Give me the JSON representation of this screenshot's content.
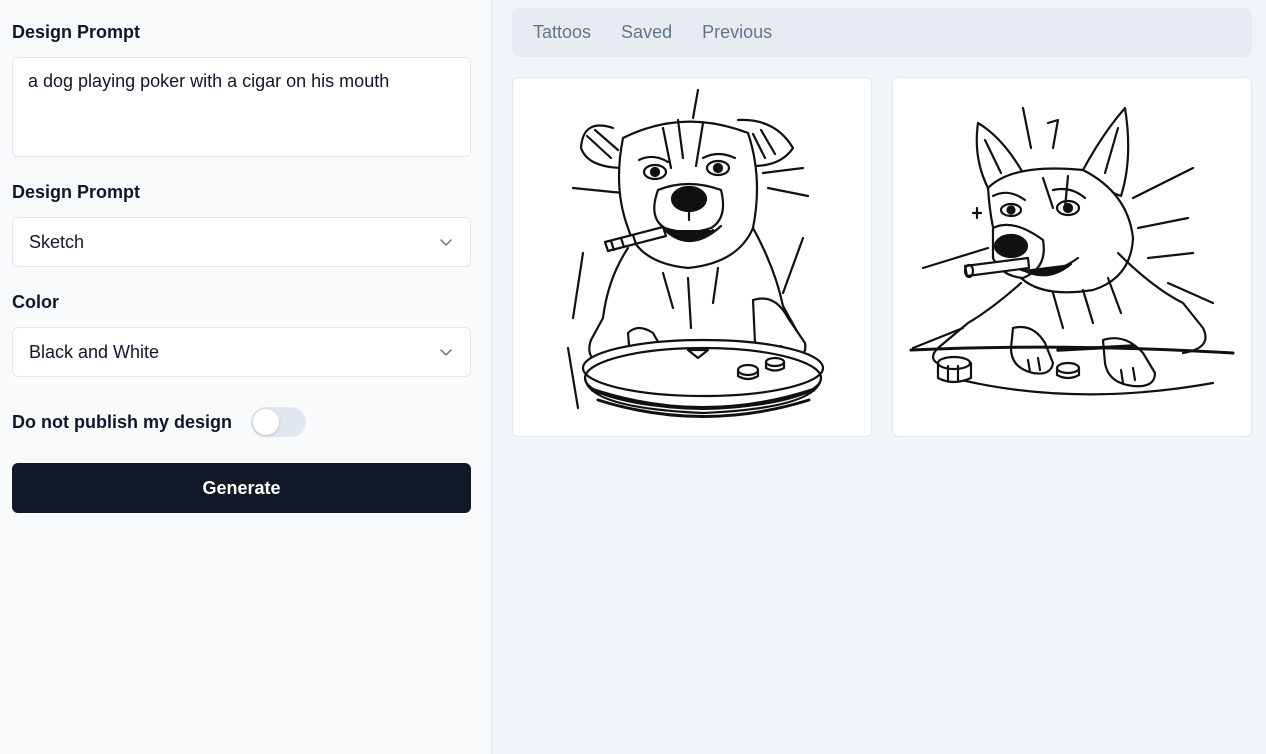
{
  "form": {
    "prompt_label": "Design Prompt",
    "prompt_value": "a dog playing poker with a cigar on his mouth",
    "style_label": "Design Prompt",
    "style_value": "Sketch",
    "color_label": "Color",
    "color_value": "Black and White",
    "publish_label": "Do not publish my design",
    "publish_toggle_on": false,
    "generate_label": "Generate"
  },
  "tabs": [
    {
      "label": "Tattoos"
    },
    {
      "label": "Saved"
    },
    {
      "label": "Previous"
    }
  ],
  "gallery": [
    {
      "icon": "dog-boxer-sketch-image"
    },
    {
      "icon": "dog-shepherd-sketch-image"
    }
  ],
  "colors": {
    "primary_button": "#111827",
    "panel_bg": "#f8fafc",
    "main_bg": "#f1f4f9",
    "tab_bar_bg": "#e7ecf3",
    "border": "#e2e8f0"
  }
}
